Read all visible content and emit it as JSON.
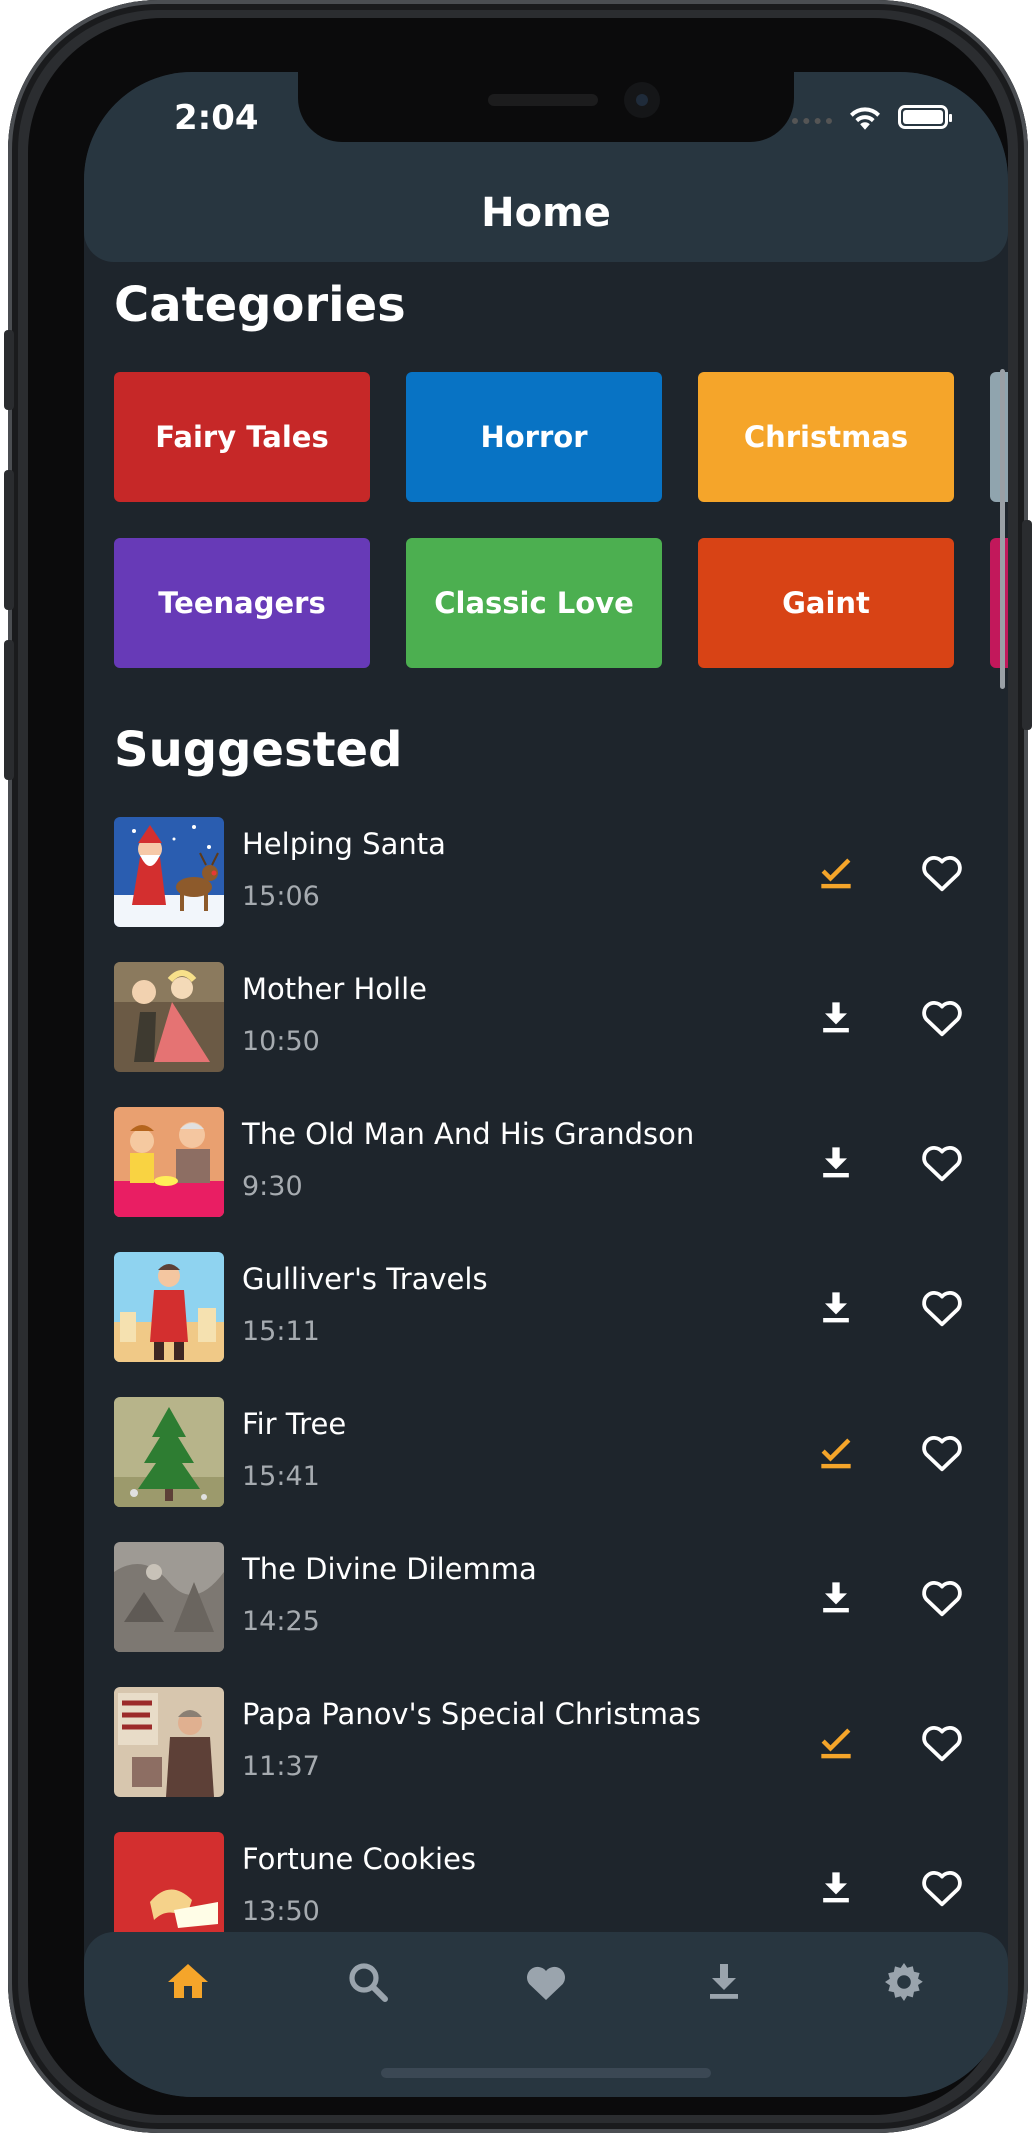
{
  "status_bar": {
    "time": "2:04"
  },
  "header": {
    "title": "Home"
  },
  "categories": {
    "heading": "Categories",
    "items": [
      {
        "label": "Fairy Tales",
        "color": "#c62828"
      },
      {
        "label": "Horror",
        "color": "#0873c4"
      },
      {
        "label": "Christmas",
        "color": "#f5a52a"
      },
      {
        "label": "Teenagers",
        "color": "#673ab7"
      },
      {
        "label": "Classic Love",
        "color": "#4caf50"
      },
      {
        "label": "Gaint",
        "color": "#d84315"
      }
    ]
  },
  "suggested": {
    "heading": "Suggested",
    "items": [
      {
        "title": "Helping Santa",
        "duration": "15:06",
        "downloaded": true
      },
      {
        "title": "Mother Holle",
        "duration": "10:50",
        "downloaded": false
      },
      {
        "title": "The Old Man And His Grandson",
        "duration": "9:30",
        "downloaded": false
      },
      {
        "title": "Gulliver's Travels",
        "duration": "15:11",
        "downloaded": false
      },
      {
        "title": "Fir Tree",
        "duration": "15:41",
        "downloaded": true
      },
      {
        "title": "The Divine Dilemma",
        "duration": "14:25",
        "downloaded": false
      },
      {
        "title": "Papa Panov's Special Christmas",
        "duration": "11:37",
        "downloaded": true
      },
      {
        "title": "Fortune Cookies",
        "duration": "13:50",
        "downloaded": false
      }
    ]
  },
  "tab_bar": {
    "active": "home",
    "tabs": [
      {
        "icon": "home-icon"
      },
      {
        "icon": "search-icon"
      },
      {
        "icon": "heart-icon"
      },
      {
        "icon": "download-icon"
      },
      {
        "icon": "settings-icon"
      }
    ]
  },
  "colors": {
    "accent": "#f5a52a",
    "background": "#1e252c",
    "bar": "#283640",
    "muted_text": "#a6abb0"
  }
}
